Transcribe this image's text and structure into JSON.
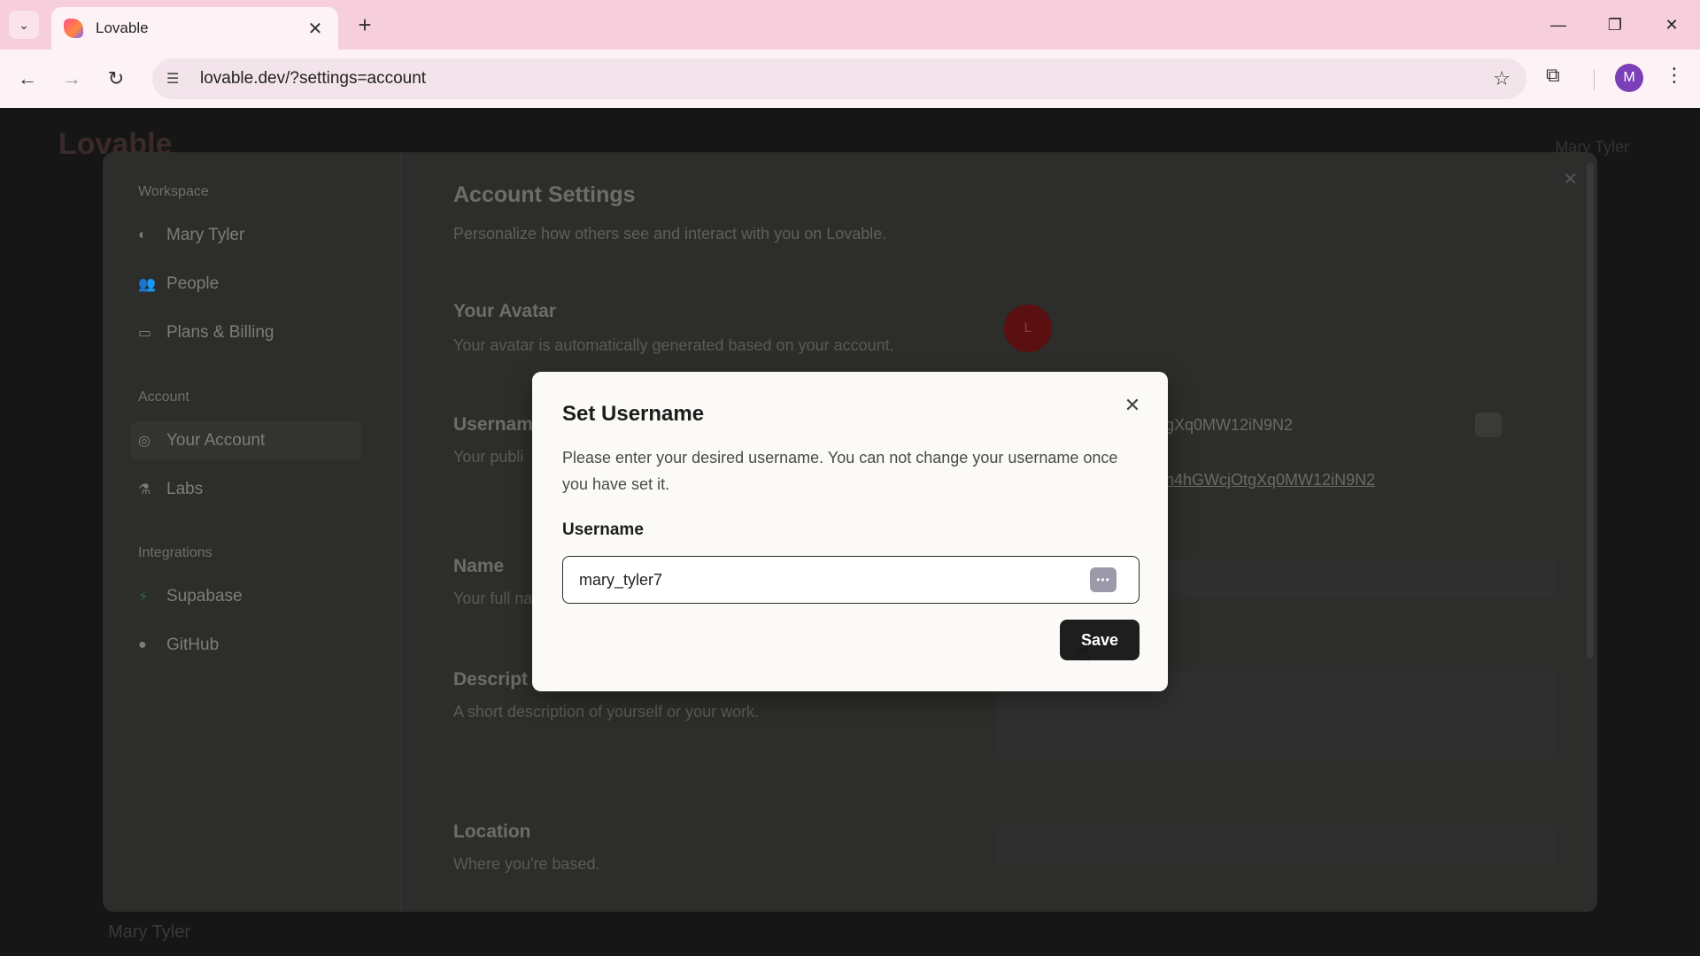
{
  "browser": {
    "tab_title": "Lovable",
    "url": "lovable.dev/?settings=account",
    "profile_initial": "M",
    "icons": {
      "tab_dropdown": "chevron-down-icon",
      "tab_close": "close-icon",
      "new_tab": "plus-icon",
      "back": "arrow-left-icon",
      "forward": "arrow-right-icon",
      "reload": "reload-icon",
      "site_info": "tune-icon",
      "bookmark": "star-icon",
      "extensions": "puzzle-icon",
      "menu": "kebab-icon"
    }
  },
  "background": {
    "logo": "Lovable",
    "user_name": "Mary Tyler",
    "bottom_user_name": "Mary Tyler"
  },
  "sidebar": {
    "sections": [
      {
        "title": "Workspace",
        "items": [
          {
            "label": "Mary Tyler",
            "icon": "workspace-icon"
          },
          {
            "label": "People",
            "icon": "people-icon"
          },
          {
            "label": "Plans & Billing",
            "icon": "credit-card-icon"
          }
        ]
      },
      {
        "title": "Account",
        "items": [
          {
            "label": "Your Account",
            "icon": "user-circle-icon"
          },
          {
            "label": "Labs",
            "icon": "flask-icon"
          }
        ]
      },
      {
        "title": "Integrations",
        "items": [
          {
            "label": "Supabase",
            "icon": "supabase-icon"
          },
          {
            "label": "GitHub",
            "icon": "github-icon"
          }
        ]
      }
    ]
  },
  "settings": {
    "title": "Account Settings",
    "subtitle": "Personalize how others see and interact with you on Lovable.",
    "avatar": {
      "title": "Your Avatar",
      "desc": "Your avatar is automatically generated based on your account.",
      "initial": "L"
    },
    "username": {
      "title": "Usernam",
      "desc": "Your publi",
      "value_fragment": "gXq0MW12iN9N2",
      "link_fragment": "h4hGWcjOtgXq0MW12iN9N2"
    },
    "name": {
      "title": "Name",
      "desc": "Your full na"
    },
    "description": {
      "title": "Descript",
      "desc": "A short description of yourself or your work."
    },
    "location": {
      "title": "Location",
      "desc": "Where you're based."
    }
  },
  "modal": {
    "title": "Set Username",
    "description": "Please enter your desired username. You can not change your username once you have set it.",
    "field_label": "Username",
    "field_value": "mary_tyler7",
    "save_label": "Save"
  }
}
